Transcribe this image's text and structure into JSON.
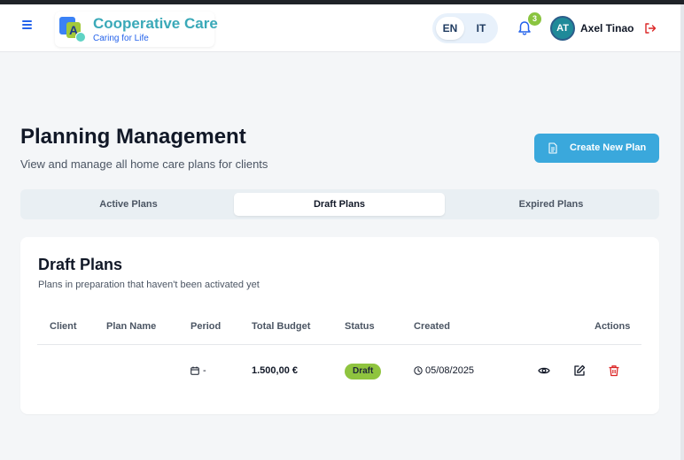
{
  "header": {
    "brand_title": "Cooperative Care",
    "brand_subtitle": "Caring for Life",
    "logo_letter": "A",
    "languages": [
      "EN",
      "IT"
    ],
    "selected_language": "EN",
    "notification_count": "3",
    "user_initials": "AT",
    "user_name": "Axel Tinao"
  },
  "page": {
    "title": "Planning Management",
    "subtitle": "View and manage all home care plans for clients",
    "create_button_label": "Create New Plan"
  },
  "tabs": [
    {
      "label": "Active Plans",
      "active": false
    },
    {
      "label": "Draft Plans",
      "active": true
    },
    {
      "label": "Expired Plans",
      "active": false
    }
  ],
  "card": {
    "title": "Draft Plans",
    "subtitle": "Plans in preparation that haven't been activated yet",
    "columns": [
      "Client",
      "Plan Name",
      "Period",
      "Total Budget",
      "Status",
      "Created",
      "Actions"
    ],
    "rows": [
      {
        "client": "",
        "plan_name": "",
        "period": "-",
        "total_budget": "1.500,00 €",
        "status": "Draft",
        "created": "05/08/2025"
      }
    ]
  },
  "colors": {
    "accent": "#3aa8dc",
    "brand": "#3aa9b8",
    "draft_badge": "#8fc43f",
    "delete": "#dc2626"
  },
  "icons": {
    "menu": "hamburger-icon",
    "notifications": "bell-icon",
    "logout": "logout-icon",
    "create": "document-icon",
    "period": "calendar-icon",
    "created": "clock-icon",
    "view": "eye-icon",
    "edit": "edit-icon",
    "delete": "trash-icon"
  }
}
